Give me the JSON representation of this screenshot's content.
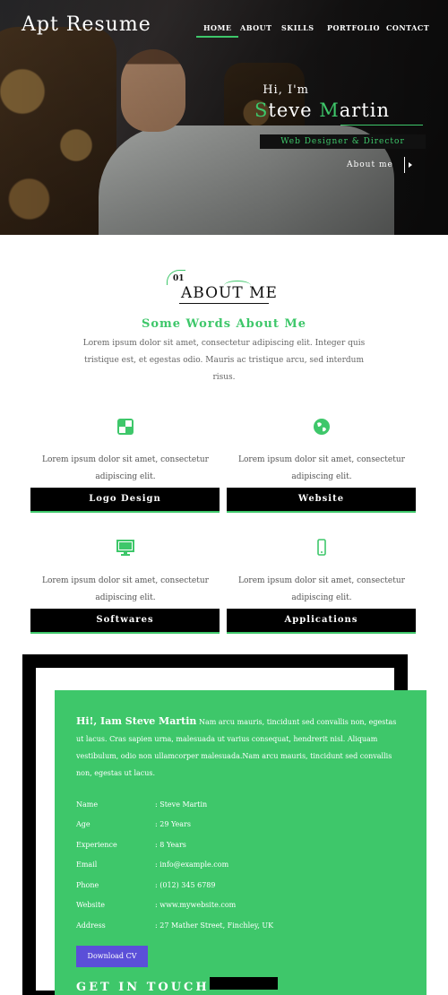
{
  "brand": "Apt Resume",
  "nav": [
    "HOME",
    "ABOUT",
    "SKILLS",
    "PORTFOLIO",
    "CONTACT"
  ],
  "hero": {
    "greeting": "Hi, I'm",
    "name_first_initial": "S",
    "name_first_rest": "teve ",
    "name_last_initial": "M",
    "name_last_rest": "artin",
    "role": "Web Designer & Director",
    "about_link": "About me"
  },
  "about": {
    "number": "01",
    "title": "ABOUT ME",
    "subtitle": "Some Words About Me",
    "description": "Lorem ipsum dolor sit amet, consectetur adipiscing elit. Integer quis tristique est, et egestas odio. Mauris ac tristique arcu, sed interdum risus.",
    "services": [
      {
        "text": "Lorem ipsum dolor sit amet, consectetur adipiscing elit.",
        "button": "Logo Design",
        "icon": "puzzle-icon"
      },
      {
        "text": "Lorem ipsum dolor sit amet, consectetur adipiscing elit.",
        "button": "Website",
        "icon": "globe-icon"
      },
      {
        "text": "Lorem ipsum dolor sit amet, consectetur adipiscing elit.",
        "button": "Softwares",
        "icon": "monitor-icon"
      },
      {
        "text": "Lorem ipsum dolor sit amet, consectetur adipiscing elit.",
        "button": "Applications",
        "icon": "phone-icon"
      }
    ]
  },
  "profile": {
    "lead": "Hi!, Iam Steve Martin",
    "bio": "Nam arcu mauris, tincidunt sed convallis non, egestas ut lacus. Cras sapien urna, malesuada ut varius consequat, hendrerit nisl. Aliquam vestibulum, odio non ullamcorper malesuada.Nam arcu mauris, tincidunt sed convallis non, egestas ut lacus.",
    "info": [
      {
        "label": "Name",
        "value": ": Steve Martin"
      },
      {
        "label": "Age",
        "value": ": 29 Years"
      },
      {
        "label": "Experience",
        "value": ": 8 Years"
      },
      {
        "label": "Email",
        "value": ": info@example.com"
      },
      {
        "label": "Phone",
        "value": ": (012) 345 6789"
      },
      {
        "label": "Website",
        "value": ": www.mywebsite.com"
      },
      {
        "label": "Address",
        "value": ": 27 Mather Street, Finchley, UK"
      }
    ],
    "download": "Download CV",
    "get_in_touch": "GET IN TOUCH"
  },
  "colors": {
    "accent": "#3ec76a",
    "download": "#5b4fd8"
  }
}
